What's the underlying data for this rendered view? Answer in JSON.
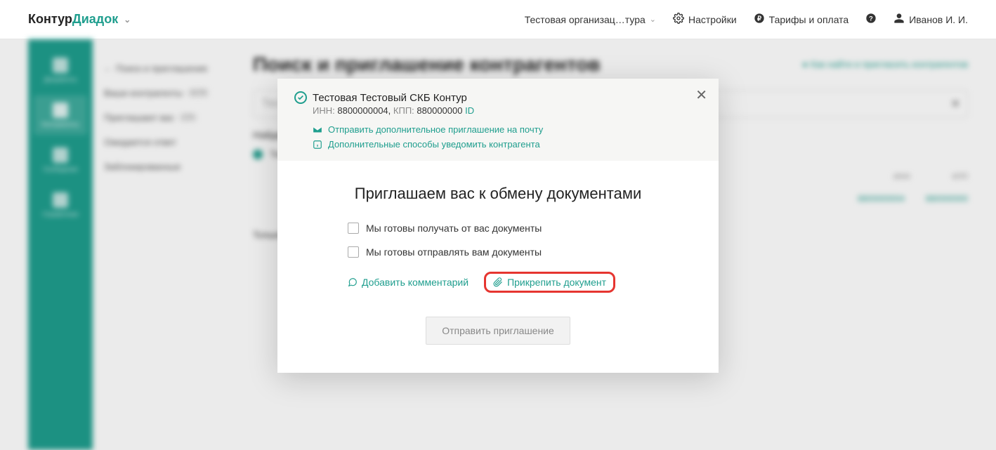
{
  "header": {
    "logo_kontur": "Контур",
    "logo_diadoc": "Диадок",
    "org_selector": "Тестовая организац…тура",
    "settings": "Настройки",
    "tariffs": "Тарифы и оплата",
    "user": "Иванов И. И."
  },
  "sidebar_rail": {
    "items": [
      {
        "label": "Документы"
      },
      {
        "label": "Контрагенты"
      },
      {
        "label": "Сообщения"
      },
      {
        "label": "Справочная"
      }
    ]
  },
  "sidebar_sub": {
    "items": [
      {
        "label": "Поиск и приглашение",
        "active": true
      },
      {
        "label": "Ваши контрагенты",
        "badge": "4179"
      },
      {
        "label": "Приглашают вас",
        "badge": "174"
      },
      {
        "label": "Ожидается ответ"
      },
      {
        "label": "Заблокированные"
      }
    ]
  },
  "bg": {
    "title": "Поиск и приглашение контрагентов",
    "help_link": "Как найти и пригласить контрагентов",
    "col1": "ИНН",
    "col2": "КПП",
    "link1": "8800000004",
    "link2": "880000000"
  },
  "modal": {
    "org_name": "Тестовая Тестовый СКБ Контур",
    "inn_label": "ИНН:",
    "inn_value": "8800000004,",
    "kpp_label": "КПП:",
    "kpp_value": "880000000",
    "id_link": "ID",
    "link_email": "Отправить дополнительное приглашение на почту",
    "link_notify": "Дополнительные способы уведомить контрагента",
    "title": "Приглашаем вас к обмену документами",
    "checkbox1": "Мы готовы получать от вас документы",
    "checkbox2": "Мы готовы отправлять вам документы",
    "add_comment": "Добавить комментарий",
    "attach_doc": "Прикрепить документ",
    "submit": "Отправить приглашение"
  }
}
